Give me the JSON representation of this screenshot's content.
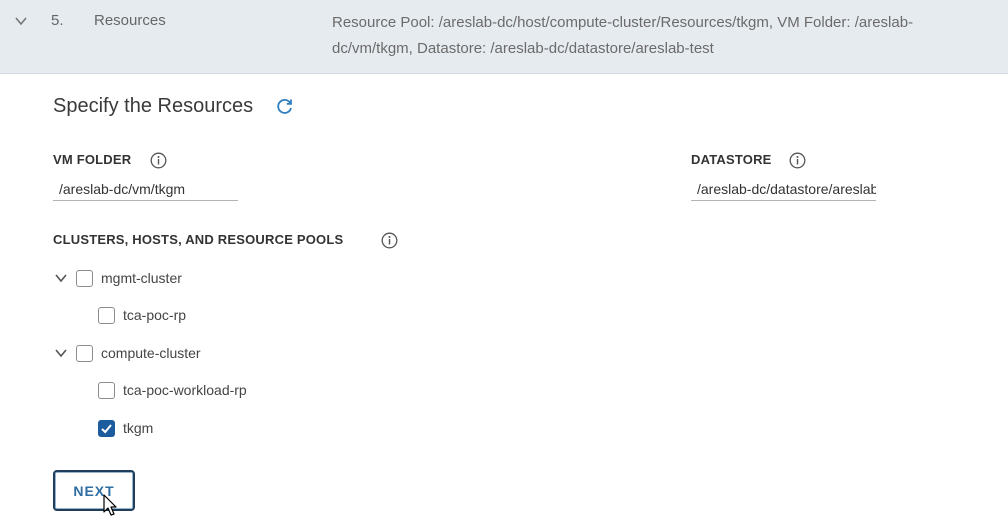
{
  "step": {
    "number": "5.",
    "title": "Resources",
    "summary": "Resource Pool: /areslab-dc/host/compute-cluster/Resources/tkgm, VM Folder: /areslab-\ndc/vm/tkgm, Datastore: /areslab-dc/datastore/areslab-test"
  },
  "section": {
    "title": "Specify the Resources"
  },
  "fields": {
    "vm_folder_label": "VM FOLDER",
    "vm_folder_value": "/areslab-dc/vm/tkgm",
    "datastore_label": "DATASTORE",
    "datastore_value": "/areslab-dc/datastore/areslab-test"
  },
  "tree": {
    "label": "CLUSTERS, HOSTS, AND RESOURCE POOLS",
    "items": [
      {
        "label": "mgmt-cluster",
        "checked": false,
        "expandable": true
      },
      {
        "label": "tca-poc-rp",
        "checked": false,
        "expandable": false
      },
      {
        "label": "compute-cluster",
        "checked": false,
        "expandable": true
      },
      {
        "label": "tca-poc-workload-rp",
        "checked": false,
        "expandable": false
      },
      {
        "label": "tkgm",
        "checked": true,
        "expandable": false
      }
    ]
  },
  "actions": {
    "next_label": "NEXT"
  },
  "colors": {
    "header_bg": "#e6ebf0",
    "accent": "#1b5b9e",
    "checkbox_checked": "#1b5b9e"
  }
}
